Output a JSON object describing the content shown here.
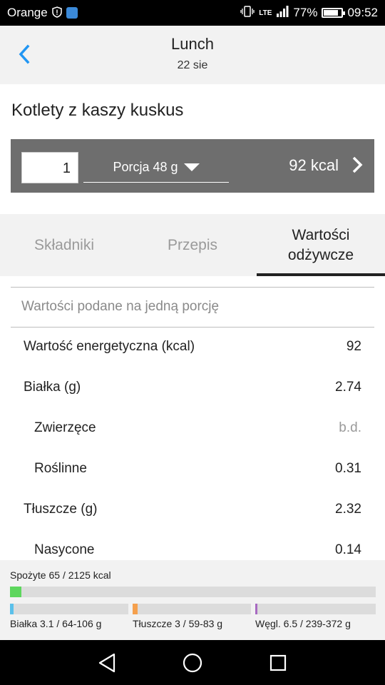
{
  "status_bar": {
    "carrier": "Orange",
    "network": "LTE",
    "battery": "77%",
    "battery_level": 0.77,
    "time": "09:52"
  },
  "header": {
    "title": "Lunch",
    "date": "22 sie"
  },
  "recipe": {
    "name": "Kotlety z kaszy kuskus"
  },
  "portion": {
    "quantity": "1",
    "unit": "Porcja 48 g",
    "kcal": "92 kcal"
  },
  "tabs": [
    {
      "label": "Składniki",
      "active": false
    },
    {
      "label": "Przepis",
      "active": false
    },
    {
      "label": "Wartości odżywcze",
      "active": true
    }
  ],
  "nutrition": {
    "note": "Wartości podane na jedną porcję",
    "rows": [
      {
        "label": "Wartość energetyczna (kcal)",
        "value": "92"
      },
      {
        "label": "Białka (g)",
        "value": "2.74"
      },
      {
        "label": "Zwierzęce",
        "value": "b.d."
      },
      {
        "label": "Roślinne",
        "value": "0.31"
      },
      {
        "label": "Tłuszcze (g)",
        "value": "2.32"
      },
      {
        "label": "Nasycone",
        "value": "0.14"
      }
    ]
  },
  "footer": {
    "consumed": "Spożyte  65 / 2125 kcal",
    "consumed_fraction": 0.031,
    "macros": [
      {
        "label": "Białka  3.1 / 64-106 g",
        "fraction": 0.03,
        "color": "#5bc0ea"
      },
      {
        "label": "Tłuszcze  3 / 59-83 g",
        "fraction": 0.04,
        "color": "#f5a04d"
      },
      {
        "label": "Węgl.  6.5 / 239-372 g",
        "fraction": 0.02,
        "color": "#a86ac2"
      }
    ]
  },
  "colors": {
    "accent": "#2196f3",
    "portion_bar": "#6e6e6e",
    "progress_green": "#5dd65d"
  }
}
